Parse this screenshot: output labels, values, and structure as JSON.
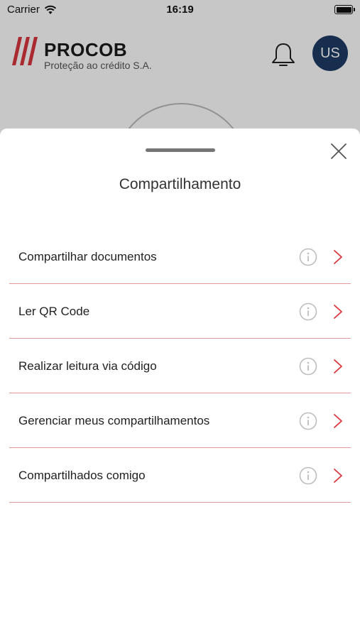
{
  "status_bar": {
    "carrier": "Carrier",
    "time": "16:19"
  },
  "header": {
    "brand_name": "PROCOB",
    "tagline": "Proteção ao crédito S.A.",
    "avatar_initials": "US"
  },
  "sheet": {
    "title": "Compartilhamento",
    "items": [
      {
        "label": "Compartilhar documentos"
      },
      {
        "label": "Ler QR Code"
      },
      {
        "label": "Realizar leitura via código"
      },
      {
        "label": "Gerenciar meus compartilhamentos"
      },
      {
        "label": "Compartilhados comigo"
      }
    ]
  },
  "colors": {
    "accent": "#d9363e",
    "divider": "#e39a9a",
    "avatar": "#1f3b66",
    "icon_gray": "#bdbdbd"
  },
  "icons": {
    "close": "close-icon",
    "info": "info-icon",
    "chevron": "chevron-right-icon",
    "bell": "bell-icon",
    "wifi": "wifi-icon",
    "battery": "battery-icon"
  }
}
